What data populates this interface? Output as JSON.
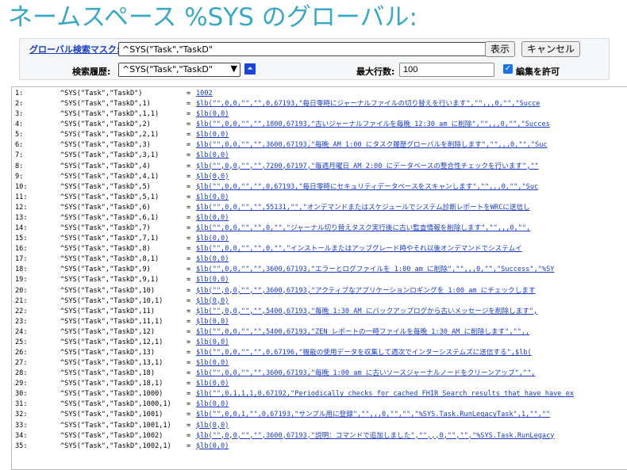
{
  "page": {
    "title": "ネームスペース %SYS のグローバル:"
  },
  "form": {
    "mask_label": "グローバル検索マスク:",
    "mask_value": "^SYS(\"Task\",\"TaskD\"",
    "show_button": "表示",
    "cancel_button": "キャンセル",
    "history_label": "検索履歴:",
    "history_value": "^SYS(\"Task\",\"TaskD\"",
    "max_rows_label": "最大行数:",
    "max_rows_value": "100",
    "edit_checked": true,
    "edit_label": "編集を許可"
  },
  "colors": {
    "title": "#3aa8c4",
    "link": "#1a3dbe",
    "accent": "#1a73e8"
  },
  "rows": [
    {
      "num": "1:",
      "node": "^SYS(\"Task\",\"TaskD\")",
      "eq": "=",
      "value": "1002"
    },
    {
      "num": "2:",
      "node": "^SYS(\"Task\",\"TaskD\",1)",
      "eq": "=",
      "value": "$lb(\"\",0,0,\"\",\"\",0,67193,\"毎日零時にジャーナルファイルの切り替えを行います\",\"\",,,0,\"\",\"Succe"
    },
    {
      "num": "3:",
      "node": "^SYS(\"Task\",\"TaskD\",1,1)",
      "eq": "=",
      "value": "$lb(0,0)"
    },
    {
      "num": "4:",
      "node": "^SYS(\"Task\",\"TaskD\",2)",
      "eq": "=",
      "value": "$lb(\"\",0,0,\"\",\"\",1800,67193,\"古いジャーナルファイルを毎晩 12:30 am に削除\",\"\",,,0,\"\",\"Succes"
    },
    {
      "num": "5:",
      "node": "^SYS(\"Task\",\"TaskD\",2,1)",
      "eq": "=",
      "value": "$lb(0,0)"
    },
    {
      "num": "6:",
      "node": "^SYS(\"Task\",\"TaskD\",3)",
      "eq": "=",
      "value": "$lb(\"\",0,0,\"\",\"\",3600,67193,\"毎晩 AM 1:00 にタスク履歴グローバルを削除します\",\"\",,,0,\"\",\"Suc"
    },
    {
      "num": "7:",
      "node": "^SYS(\"Task\",\"TaskD\",3,1)",
      "eq": "=",
      "value": "$lb(0,0)"
    },
    {
      "num": "8:",
      "node": "^SYS(\"Task\",\"TaskD\",4)",
      "eq": "=",
      "value": "$lb(\"\",0,0,\"\",\"\",7200,67197,\"毎週月曜日 AM 2:00 にデータベースの整合性チェックを行います\",\"\""
    },
    {
      "num": "9:",
      "node": "^SYS(\"Task\",\"TaskD\",4,1)",
      "eq": "=",
      "value": "$lb(0,0)"
    },
    {
      "num": "10:",
      "node": "^SYS(\"Task\",\"TaskD\",5)",
      "eq": "=",
      "value": "$lb(\"\",0,0,\"\",\"\",0,67193,\"毎日零時にセキュリティデータベースをスキャンします\",\"\",,,0,\"\",\"Suc"
    },
    {
      "num": "11:",
      "node": "^SYS(\"Task\",\"TaskD\",5,1)",
      "eq": "=",
      "value": "$lb(0,0)"
    },
    {
      "num": "12:",
      "node": "^SYS(\"Task\",\"TaskD\",6)",
      "eq": "=",
      "value": "$lb(\"\",0,0,\"\",\"\",55131,\"\",\"オンデマンドまたはスケジュールでシステム診断レポートをWRCに送信し"
    },
    {
      "num": "13:",
      "node": "^SYS(\"Task\",\"TaskD\",6,1)",
      "eq": "=",
      "value": "$lb(0,0)"
    },
    {
      "num": "14:",
      "node": "^SYS(\"Task\",\"TaskD\",7)",
      "eq": "=",
      "value": "$lb(\"\",0,0,\"\",\"\",0,\"\",\"ジャーナル切り替えタスク実行後に古い監査情報を削除します\",\"\",,,0,\"\","
    },
    {
      "num": "15:",
      "node": "^SYS(\"Task\",\"TaskD\",7,1)",
      "eq": "=",
      "value": "$lb(0,0)"
    },
    {
      "num": "16:",
      "node": "^SYS(\"Task\",\"TaskD\",8)",
      "eq": "=",
      "value": "$lb(\"\",0,0,\"\",\"\",0,\"\",\"インストールまたはアップグレード時やそれ以後オンデマンドでシステムイ"
    },
    {
      "num": "17:",
      "node": "^SYS(\"Task\",\"TaskD\",8,1)",
      "eq": "=",
      "value": "$lb(0,0)"
    },
    {
      "num": "18:",
      "node": "^SYS(\"Task\",\"TaskD\",9)",
      "eq": "=",
      "value": "$lb(\"\",0,0,\"\",\"\",3600,67193,\"エラーとログファイルを 1:00 am に削除\",\"\",,,0,\"\",\"Success\",\"%SY"
    },
    {
      "num": "19:",
      "node": "^SYS(\"Task\",\"TaskD\",9,1)",
      "eq": "=",
      "value": "$lb(0,0)"
    },
    {
      "num": "20:",
      "node": "^SYS(\"Task\",\"TaskD\",10)",
      "eq": "=",
      "value": "$lb(\"\",0,0,\"\",\"\",3600,67193,\"アクティブなアプリケーションロギングを 1:00 am にチェックします"
    },
    {
      "num": "21:",
      "node": "^SYS(\"Task\",\"TaskD\",10,1)",
      "eq": "=",
      "value": "$lb(0,0)"
    },
    {
      "num": "22:",
      "node": "^SYS(\"Task\",\"TaskD\",11)",
      "eq": "=",
      "value": "$lb(\"\",0,0,\"\",\"\",5400,67193,\"毎晩 1:30 AM にバックアップログから古いメッセージを削除します\","
    },
    {
      "num": "23:",
      "node": "^SYS(\"Task\",\"TaskD\",11,1)",
      "eq": "=",
      "value": "$lb(0,0)"
    },
    {
      "num": "24:",
      "node": "^SYS(\"Task\",\"TaskD\",12)",
      "eq": "=",
      "value": "$lb(\"\",0,0,\"\",\"\",5400,67193,\"ZEN レポートの一時ファイルを毎晩 1:30 AM に削除します\",\"\",,"
    },
    {
      "num": "25:",
      "node": "^SYS(\"Task\",\"TaskD\",12,1)",
      "eq": "=",
      "value": "$lb(0,0)"
    },
    {
      "num": "26:",
      "node": "^SYS(\"Task\",\"TaskD\",13)",
      "eq": "=",
      "value": "$lb(\"\",0,0,\"\",\"\",0,67196,\"機能の使用データを収集して週次でインターシステムズに送信する\",$lb("
    },
    {
      "num": "27:",
      "node": "^SYS(\"Task\",\"TaskD\",13,1)",
      "eq": "=",
      "value": "$lb(0,0)"
    },
    {
      "num": "28:",
      "node": "^SYS(\"Task\",\"TaskD\",18)",
      "eq": "=",
      "value": "$lb(\"\",0,0,\"\",\"\",3600,67193,\"毎晩 1:00 am に古いソースジャーナルノードをクリーンアップ\",\"\","
    },
    {
      "num": "29:",
      "node": "^SYS(\"Task\",\"TaskD\",18,1)",
      "eq": "=",
      "value": "$lb(0,0)"
    },
    {
      "num": "30:",
      "node": "^SYS(\"Task\",\"TaskD\",1000)",
      "eq": "=",
      "value": "$lb(\"\",0,1,1,1,0,67192,\"Periodically checks for cached FHIR Search results that have have ex"
    },
    {
      "num": "31:",
      "node": "^SYS(\"Task\",\"TaskD\",1000,1)",
      "eq": "=",
      "value": "$lb(0,0)"
    },
    {
      "num": "32:",
      "node": "^SYS(\"Task\",\"TaskD\",1001)",
      "eq": "=",
      "value": "$lb(\"\",0,0,1,\"\",0,67193,\"サンプル用に登録\",\"\",,,0,\"\",\"\",\"%SYS.Task.RunLegacyTask\",1,\"\",\"\""
    },
    {
      "num": "33:",
      "node": "^SYS(\"Task\",\"TaskD\",1001,1)",
      "eq": "=",
      "value": "$lb(0,0)"
    },
    {
      "num": "34:",
      "node": "^SYS(\"Task\",\"TaskD\",1002)",
      "eq": "=",
      "value": "$lb(\"\",0,0,\"\",\"\",3600,67193,\"説明：コマンドで追加しました\",\"\",,,0,\"\",\"\",\"%SYS.Task.RunLegacy"
    },
    {
      "num": "35:",
      "node": "^SYS(\"Task\",\"TaskD\",1002,1)",
      "eq": "=",
      "value": "$lb(0,0)"
    }
  ]
}
